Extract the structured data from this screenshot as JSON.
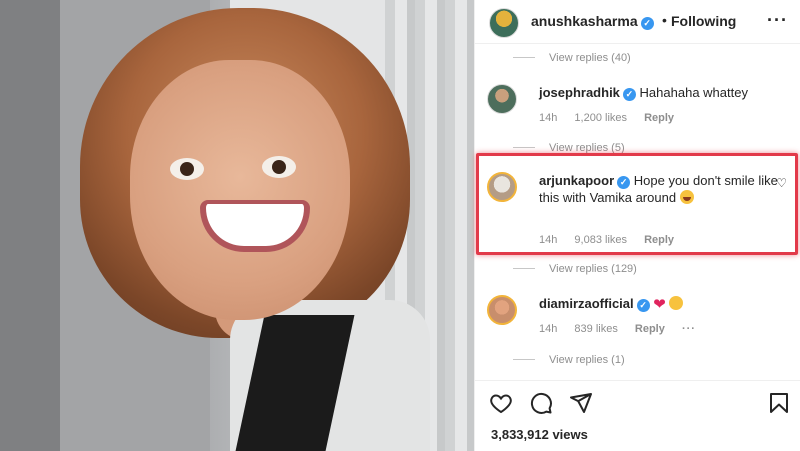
{
  "post": {
    "author": "anushkasharma",
    "follow_separator": "•",
    "follow_status": "Following",
    "more_icon": "ellipsis-icon"
  },
  "comments": {
    "replies_top": "View replies (40)",
    "c1": {
      "username": "josephradhik",
      "text": "Hahahaha whattey",
      "time": "14h",
      "likes": "1,200 likes",
      "reply": "Reply",
      "replies": "View replies (5)"
    },
    "c2": {
      "username": "arjunkapoor",
      "text": "Hope you don't smile like this with Vamika around",
      "time": "14h",
      "likes": "9,083 likes",
      "reply": "Reply",
      "replies": "View replies (129)"
    },
    "c3": {
      "username": "diamirzaofficial",
      "time": "14h",
      "likes": "839 likes",
      "reply": "Reply",
      "more": "···",
      "replies": "View replies (1)"
    }
  },
  "footer": {
    "views": "3,833,912 views"
  },
  "colors": {
    "accent_blue": "#3897f0",
    "highlight_red": "#e23a4a",
    "heart_red": "#e0245e"
  },
  "icons": [
    "verified-badge-icon",
    "heart-icon",
    "comment-icon",
    "share-icon",
    "bookmark-icon",
    "laughing-emoji-icon",
    "smiling-emoji-icon"
  ]
}
